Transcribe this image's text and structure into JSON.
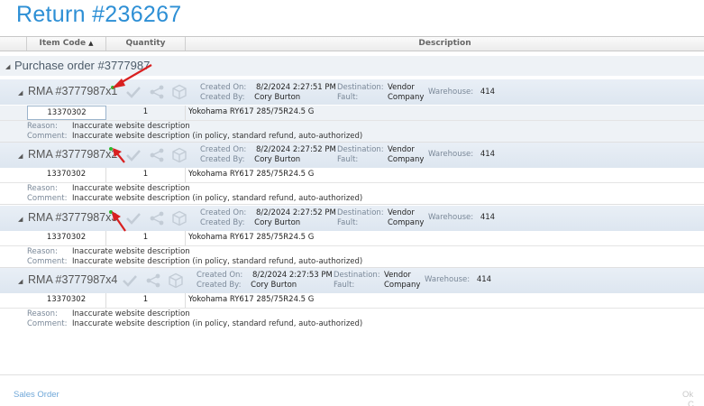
{
  "title": "Return #236267",
  "grid": {
    "col_item_code": "Item Code",
    "col_quantity": "Quantity",
    "col_description": "Description"
  },
  "purchase_order": "Purchase order #3777987",
  "labels": {
    "created_on": "Created On:",
    "created_by": "Created By:",
    "destination": "Destination:",
    "fault": "Fault:",
    "warehouse": "Warehouse:",
    "reason": "Reason:",
    "comment": "Comment:"
  },
  "rmas": [
    {
      "title": "RMA #3777987x1",
      "created_on": "8/2/2024 2:27:51 PM",
      "created_by": "Cory Burton",
      "destination_line1": "Vendor",
      "destination_line2": "Company",
      "warehouse": "414",
      "item": {
        "code": "13370302",
        "qty": "1",
        "description": "Yokohama RY617 285/75R24.5 G"
      },
      "reason": "Inaccurate website description",
      "comment": "Inaccurate website description (in policy, standard refund, auto-authorized)"
    },
    {
      "title": "RMA #3777987x2",
      "created_on": "8/2/2024 2:27:52 PM",
      "created_by": "Cory Burton",
      "destination_line1": "Vendor",
      "destination_line2": "Company",
      "warehouse": "414",
      "item": {
        "code": "13370302",
        "qty": "1",
        "description": "Yokohama RY617 285/75R24.5 G"
      },
      "reason": "Inaccurate website description",
      "comment": "Inaccurate website description (in policy, standard refund, auto-authorized)"
    },
    {
      "title": "RMA #3777987x3",
      "created_on": "8/2/2024 2:27:52 PM",
      "created_by": "Cory Burton",
      "destination_line1": "Vendor",
      "destination_line2": "Company",
      "warehouse": "414",
      "item": {
        "code": "13370302",
        "qty": "1",
        "description": "Yokohama RY617 285/75R24.5 G"
      },
      "reason": "Inaccurate website description",
      "comment": "Inaccurate website description (in policy, standard refund, auto-authorized)"
    },
    {
      "title": "RMA #3777987x4",
      "created_on": "8/2/2024 2:27:53 PM",
      "created_by": "Cory Burton",
      "destination_line1": "Vendor",
      "destination_line2": "Company",
      "warehouse": "414",
      "item": {
        "code": "13370302",
        "qty": "1",
        "description": "Yokohama RY617 285/75R24.5 G"
      },
      "reason": "Inaccurate website description",
      "comment": "Inaccurate website description (in policy, standard refund, auto-authorized)"
    }
  ],
  "footer": {
    "sales_order_link": "Sales Order",
    "ok_label": "Ok",
    "cancel_label": "C"
  },
  "icons": [
    "approve-check-icon",
    "share-icon",
    "package-box-icon",
    "collapse-triangle-icon",
    "sort-ascending-icon",
    "annotation-arrow-icon"
  ],
  "colors": {
    "title_blue": "#2d8fd5",
    "header_band": "#dde6f0",
    "annotation_red": "#d92020",
    "status_green": "#2eb82e",
    "link_blue": "#6fa7d8"
  }
}
